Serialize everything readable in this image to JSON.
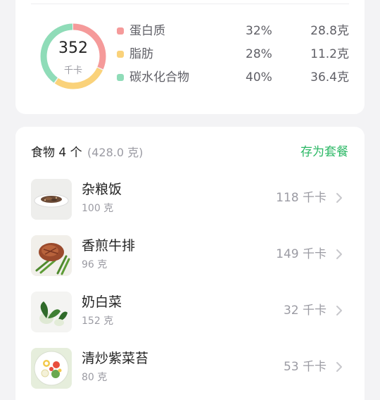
{
  "summary": {
    "total_kcal": "352",
    "kcal_unit": "千卡",
    "macros": [
      {
        "name": "蛋白质",
        "percent": "32%",
        "amount": "28.8克",
        "color": "#f59a9a",
        "fraction": 0.32
      },
      {
        "name": "脂肪",
        "percent": "28%",
        "amount": "11.2克",
        "color": "#fad27a",
        "fraction": 0.28
      },
      {
        "name": "碳水化合物",
        "percent": "40%",
        "amount": "36.4克",
        "color": "#8fdcb8",
        "fraction": 0.4
      }
    ]
  },
  "food_list": {
    "title": "食物 4 个",
    "total_weight": "(428.0 克)",
    "save_label": "存为套餐",
    "items": [
      {
        "name": "杂粮饭",
        "weight": "100 克",
        "kcal": "118 千卡",
        "icon": "grain-rice-plate"
      },
      {
        "name": "香煎牛排",
        "weight": "96 克",
        "kcal": "149 千卡",
        "icon": "steak-with-asparagus"
      },
      {
        "name": "奶白菜",
        "weight": "152 克",
        "kcal": "32 千卡",
        "icon": "bok-choy"
      },
      {
        "name": "清炒紫菜苔",
        "weight": "80 克",
        "kcal": "53 千卡",
        "icon": "salad-plate"
      }
    ]
  }
}
